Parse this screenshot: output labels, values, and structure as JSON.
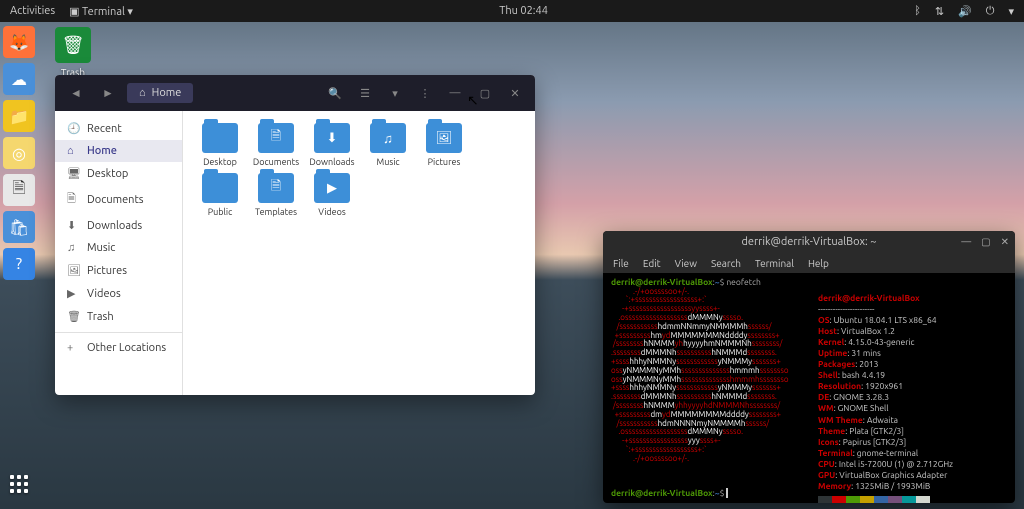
{
  "topbar": {
    "activities": "Activities",
    "app_label": "Terminal ▾",
    "clock": "Thu 02:44"
  },
  "trash": {
    "label": "Trash"
  },
  "filewin": {
    "path_label": "Home",
    "sidebar": [
      {
        "icon": "🕘",
        "label": "Recent"
      },
      {
        "icon": "⌂",
        "label": "Home",
        "active": true
      },
      {
        "icon": "🖥",
        "label": "Desktop"
      },
      {
        "icon": "🗎",
        "label": "Documents"
      },
      {
        "icon": "⬇",
        "label": "Downloads"
      },
      {
        "icon": "♫",
        "label": "Music"
      },
      {
        "icon": "🖼",
        "label": "Pictures"
      },
      {
        "icon": "▶",
        "label": "Videos"
      },
      {
        "icon": "🗑",
        "label": "Trash"
      },
      {
        "icon": "+",
        "label": "Other Locations"
      }
    ],
    "folders": [
      {
        "glyph": "",
        "label": "Desktop"
      },
      {
        "glyph": "🗎",
        "label": "Documents"
      },
      {
        "glyph": "⬇",
        "label": "Downloads"
      },
      {
        "glyph": "♫",
        "label": "Music"
      },
      {
        "glyph": "🖼",
        "label": "Pictures"
      },
      {
        "glyph": "",
        "label": "Public"
      },
      {
        "glyph": "🗎",
        "label": "Templates"
      },
      {
        "glyph": "▶",
        "label": "Videos"
      }
    ]
  },
  "terminal": {
    "title": "derrik@derrik-VirtualBox: ~",
    "menu": [
      "File",
      "Edit",
      "View",
      "Search",
      "Terminal",
      "Help"
    ],
    "prompt_user": "derrik@derrik-VirtualBox",
    "prompt_sep": ":",
    "prompt_path": "~",
    "prompt_sym": "$",
    "command": "neofetch",
    "info_title": "derrik@derrik-VirtualBox",
    "info": [
      {
        "label": "OS",
        "val": "Ubuntu 18.04.1 LTS x86_64"
      },
      {
        "label": "Host",
        "val": "VirtualBox 1.2"
      },
      {
        "label": "Kernel",
        "val": "4.15.0-43-generic"
      },
      {
        "label": "Uptime",
        "val": "31 mins"
      },
      {
        "label": "Packages",
        "val": "2013"
      },
      {
        "label": "Shell",
        "val": "bash 4.4.19"
      },
      {
        "label": "Resolution",
        "val": "1920x961"
      },
      {
        "label": "DE",
        "val": "GNOME 3.28.3"
      },
      {
        "label": "WM",
        "val": "GNOME Shell"
      },
      {
        "label": "WM Theme",
        "val": "Adwaita"
      },
      {
        "label": "Theme",
        "val": "Plata [GTK2/3]"
      },
      {
        "label": "Icons",
        "val": "Papirus [GTK2/3]"
      },
      {
        "label": "Terminal",
        "val": "gnome-terminal"
      },
      {
        "label": "CPU",
        "val": "Intel i5-7200U (1) @ 2.712GHz"
      },
      {
        "label": "GPU",
        "val": "VirtualBox Graphics Adapter"
      },
      {
        "label": "Memory",
        "val": "1325MiB / 1993MiB"
      }
    ],
    "colors": [
      "#2e3436",
      "#cc0000",
      "#4e9a06",
      "#c4a000",
      "#3465a4",
      "#75507b",
      "#06989a",
      "#d3d7cf",
      "#555753",
      "#ef2929",
      "#8ae234",
      "#fce94f",
      "#729fcf",
      "#ad7fa8",
      "#34e2e2",
      "#eeeeec"
    ]
  }
}
